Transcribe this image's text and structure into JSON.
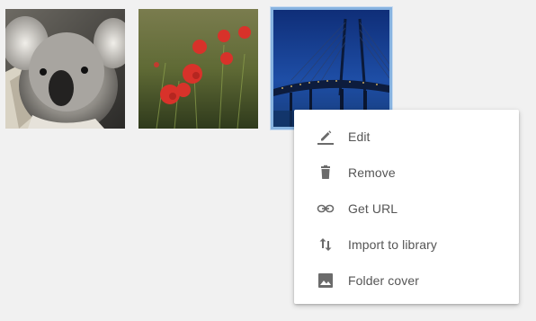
{
  "gallery": {
    "thumbnails": [
      {
        "subject": "koala"
      },
      {
        "subject": "red poppies"
      },
      {
        "subject": "cable-stayed bridge at night",
        "selected": true
      }
    ]
  },
  "context_menu": {
    "items": [
      {
        "label": "Edit",
        "icon": "pencil-icon"
      },
      {
        "label": "Remove",
        "icon": "trash-icon"
      },
      {
        "label": "Get URL",
        "icon": "link-icon"
      },
      {
        "label": "Import to library",
        "icon": "swap-vertical-icon"
      },
      {
        "label": "Folder cover",
        "icon": "image-icon"
      }
    ]
  },
  "colors": {
    "background": "#f1f1f1",
    "selection_border": "#87b3e0",
    "icon": "#6b6b6b",
    "text": "#555555"
  }
}
